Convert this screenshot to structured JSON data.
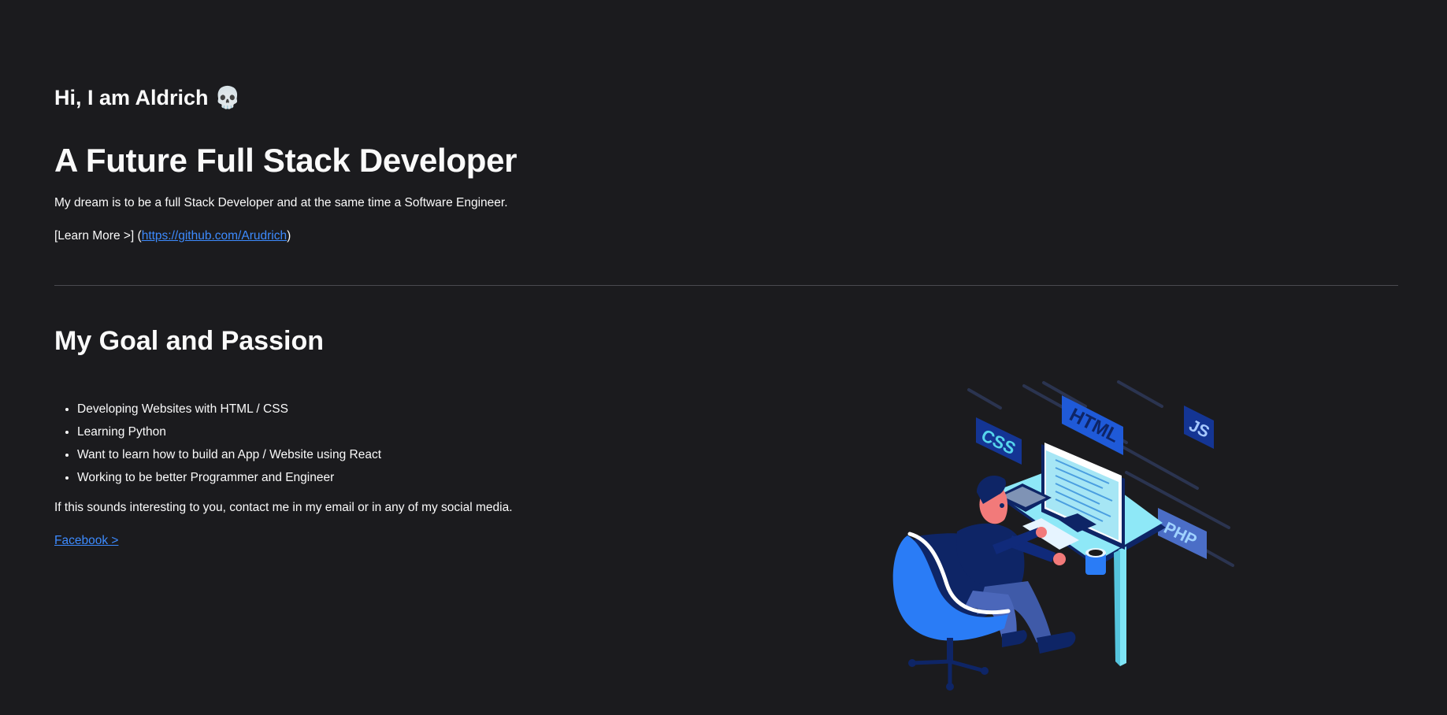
{
  "hero": {
    "greeting": "Hi, I am Aldrich",
    "greeting_emoji": "💀",
    "headline": "A Future Full Stack Developer",
    "description": "My dream is to be a full Stack Developer and at the same time a Software Engineer.",
    "learn_more_prefix": "[Learn More >] (",
    "learn_more_link": "https://github.com/Arudrich",
    "learn_more_suffix": ")"
  },
  "goals": {
    "title": "My Goal and Passion",
    "items": [
      "Developing Websites with HTML / CSS",
      "Learning Python",
      "Want to learn how to build an App / Website using React",
      "Working to be better Programmer and Engineer"
    ],
    "contact_text": "If this sounds interesting to you, contact me in my email or in any of my social media.",
    "facebook_link": "Facebook >"
  },
  "illustration": {
    "tags": {
      "html": "HTML",
      "css": "CSS",
      "js": "JS",
      "php": "PHP"
    }
  },
  "colors": {
    "background": "#1b1b1e",
    "text": "#fafafa",
    "link": "#3d8bff",
    "divider": "#4a4a50",
    "accent_blue": "#2a7cf6",
    "accent_cyan": "#8ee8f7",
    "navy": "#0e2566"
  },
  "icons": {
    "greeting_emoji": "skull-emoji",
    "list_bullet": "disc"
  }
}
